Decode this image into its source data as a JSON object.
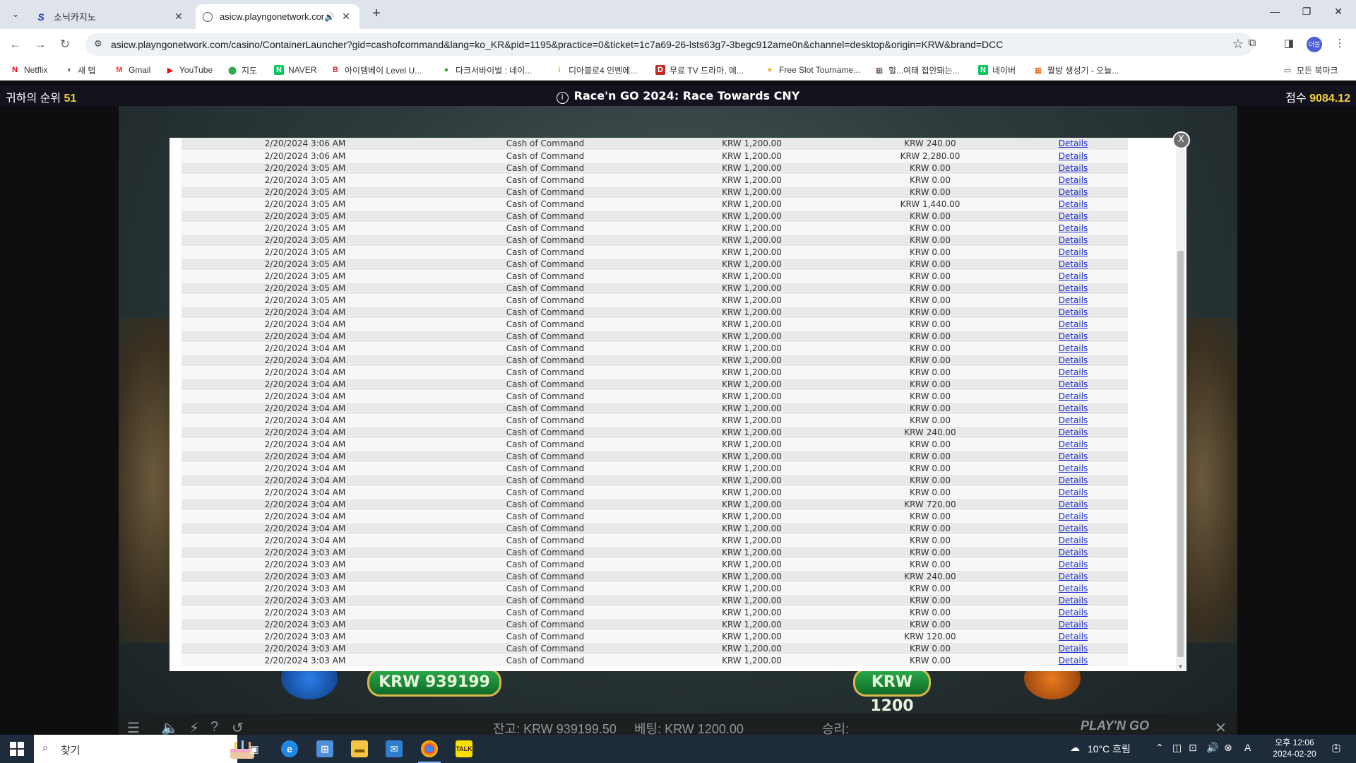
{
  "browser": {
    "tabs": [
      {
        "title": "소닉카지노",
        "active": false
      },
      {
        "title": "asicw.playngonetwork.com",
        "active": true
      }
    ],
    "new_tab": "+",
    "url": "asicw.playngonetwork.com/casino/ContainerLauncher?gid=cashofcommand&lang=ko_KR&pid=1195&practice=0&ticket=1c7a69-26-lsts63g7-3begc912ame0n&channel=desktop&origin=KRW&brand=DCC",
    "profile_initials": "더블",
    "bookmarks": [
      {
        "label": "Netflix",
        "icon": "N",
        "color": "#e50914"
      },
      {
        "label": "새 탭",
        "icon": "◑",
        "color": "#444444"
      },
      {
        "label": "Gmail",
        "icon": "M",
        "color": "#ea4335"
      },
      {
        "label": "YouTube",
        "icon": "▶",
        "color": "#ff0000"
      },
      {
        "label": "지도",
        "icon": "⬤",
        "color": "#34a853"
      },
      {
        "label": "NAVER",
        "icon": "N",
        "color": "#03c75a"
      },
      {
        "label": "아이템베이 Level U...",
        "icon": "B",
        "color": "#d32f2f"
      },
      {
        "label": "다크서바이벌 : 네이...",
        "icon": "●",
        "color": "#43a047"
      },
      {
        "label": "디아블로4 인벤에...",
        "icon": "i",
        "color": "#f9a825"
      },
      {
        "label": "무료 TV 드라마, 예...",
        "icon": "D",
        "color": "#c62828"
      },
      {
        "label": "Free Slot Tourname...",
        "icon": "●",
        "color": "#f0b429"
      },
      {
        "label": "헐...여태 접안돼는...",
        "icon": "▦",
        "color": "#6d4c41"
      },
      {
        "label": "네이버",
        "icon": "N",
        "color": "#03c75a"
      },
      {
        "label": "짤방 생성기 - 오늘...",
        "icon": "▦",
        "color": "#e65100"
      }
    ],
    "all_bookmarks": "모든 북마크"
  },
  "game": {
    "rank_label": "귀하의 순위",
    "rank_value": "51",
    "race_title": "Race'n GO 2024: Race Towards CNY",
    "score_label": "점수",
    "score_value": "9084.12",
    "pill_left": "KRW 939199",
    "pill_right": "KRW 1200",
    "balance": "잔고: KRW 939199.50",
    "bet": "베팅: KRW 1200.00",
    "win": "승리:",
    "provider": "PLAY'N GO",
    "close_glyph": "✕"
  },
  "modal": {
    "close_label": "X",
    "details_label": "Details",
    "rows": [
      [
        "2/20/2024 3:06 AM",
        "Cash of Command",
        "KRW 1,200.00",
        "KRW 240.00"
      ],
      [
        "2/20/2024 3:06 AM",
        "Cash of Command",
        "KRW 1,200.00",
        "KRW 2,280.00"
      ],
      [
        "2/20/2024 3:05 AM",
        "Cash of Command",
        "KRW 1,200.00",
        "KRW 0.00"
      ],
      [
        "2/20/2024 3:05 AM",
        "Cash of Command",
        "KRW 1,200.00",
        "KRW 0.00"
      ],
      [
        "2/20/2024 3:05 AM",
        "Cash of Command",
        "KRW 1,200.00",
        "KRW 0.00"
      ],
      [
        "2/20/2024 3:05 AM",
        "Cash of Command",
        "KRW 1,200.00",
        "KRW 1,440.00"
      ],
      [
        "2/20/2024 3:05 AM",
        "Cash of Command",
        "KRW 1,200.00",
        "KRW 0.00"
      ],
      [
        "2/20/2024 3:05 AM",
        "Cash of Command",
        "KRW 1,200.00",
        "KRW 0.00"
      ],
      [
        "2/20/2024 3:05 AM",
        "Cash of Command",
        "KRW 1,200.00",
        "KRW 0.00"
      ],
      [
        "2/20/2024 3:05 AM",
        "Cash of Command",
        "KRW 1,200.00",
        "KRW 0.00"
      ],
      [
        "2/20/2024 3:05 AM",
        "Cash of Command",
        "KRW 1,200.00",
        "KRW 0.00"
      ],
      [
        "2/20/2024 3:05 AM",
        "Cash of Command",
        "KRW 1,200.00",
        "KRW 0.00"
      ],
      [
        "2/20/2024 3:05 AM",
        "Cash of Command",
        "KRW 1,200.00",
        "KRW 0.00"
      ],
      [
        "2/20/2024 3:05 AM",
        "Cash of Command",
        "KRW 1,200.00",
        "KRW 0.00"
      ],
      [
        "2/20/2024 3:04 AM",
        "Cash of Command",
        "KRW 1,200.00",
        "KRW 0.00"
      ],
      [
        "2/20/2024 3:04 AM",
        "Cash of Command",
        "KRW 1,200.00",
        "KRW 0.00"
      ],
      [
        "2/20/2024 3:04 AM",
        "Cash of Command",
        "KRW 1,200.00",
        "KRW 0.00"
      ],
      [
        "2/20/2024 3:04 AM",
        "Cash of Command",
        "KRW 1,200.00",
        "KRW 0.00"
      ],
      [
        "2/20/2024 3:04 AM",
        "Cash of Command",
        "KRW 1,200.00",
        "KRW 0.00"
      ],
      [
        "2/20/2024 3:04 AM",
        "Cash of Command",
        "KRW 1,200.00",
        "KRW 0.00"
      ],
      [
        "2/20/2024 3:04 AM",
        "Cash of Command",
        "KRW 1,200.00",
        "KRW 0.00"
      ],
      [
        "2/20/2024 3:04 AM",
        "Cash of Command",
        "KRW 1,200.00",
        "KRW 0.00"
      ],
      [
        "2/20/2024 3:04 AM",
        "Cash of Command",
        "KRW 1,200.00",
        "KRW 0.00"
      ],
      [
        "2/20/2024 3:04 AM",
        "Cash of Command",
        "KRW 1,200.00",
        "KRW 0.00"
      ],
      [
        "2/20/2024 3:04 AM",
        "Cash of Command",
        "KRW 1,200.00",
        "KRW 240.00"
      ],
      [
        "2/20/2024 3:04 AM",
        "Cash of Command",
        "KRW 1,200.00",
        "KRW 0.00"
      ],
      [
        "2/20/2024 3:04 AM",
        "Cash of Command",
        "KRW 1,200.00",
        "KRW 0.00"
      ],
      [
        "2/20/2024 3:04 AM",
        "Cash of Command",
        "KRW 1,200.00",
        "KRW 0.00"
      ],
      [
        "2/20/2024 3:04 AM",
        "Cash of Command",
        "KRW 1,200.00",
        "KRW 0.00"
      ],
      [
        "2/20/2024 3:04 AM",
        "Cash of Command",
        "KRW 1,200.00",
        "KRW 0.00"
      ],
      [
        "2/20/2024 3:04 AM",
        "Cash of Command",
        "KRW 1,200.00",
        "KRW 720.00"
      ],
      [
        "2/20/2024 3:04 AM",
        "Cash of Command",
        "KRW 1,200.00",
        "KRW 0.00"
      ],
      [
        "2/20/2024 3:04 AM",
        "Cash of Command",
        "KRW 1,200.00",
        "KRW 0.00"
      ],
      [
        "2/20/2024 3:04 AM",
        "Cash of Command",
        "KRW 1,200.00",
        "KRW 0.00"
      ],
      [
        "2/20/2024 3:03 AM",
        "Cash of Command",
        "KRW 1,200.00",
        "KRW 0.00"
      ],
      [
        "2/20/2024 3:03 AM",
        "Cash of Command",
        "KRW 1,200.00",
        "KRW 0.00"
      ],
      [
        "2/20/2024 3:03 AM",
        "Cash of Command",
        "KRW 1,200.00",
        "KRW 240.00"
      ],
      [
        "2/20/2024 3:03 AM",
        "Cash of Command",
        "KRW 1,200.00",
        "KRW 0.00"
      ],
      [
        "2/20/2024 3:03 AM",
        "Cash of Command",
        "KRW 1,200.00",
        "KRW 0.00"
      ],
      [
        "2/20/2024 3:03 AM",
        "Cash of Command",
        "KRW 1,200.00",
        "KRW 0.00"
      ],
      [
        "2/20/2024 3:03 AM",
        "Cash of Command",
        "KRW 1,200.00",
        "KRW 0.00"
      ],
      [
        "2/20/2024 3:03 AM",
        "Cash of Command",
        "KRW 1,200.00",
        "KRW 120.00"
      ],
      [
        "2/20/2024 3:03 AM",
        "Cash of Command",
        "KRW 1,200.00",
        "KRW 0.00"
      ],
      [
        "2/20/2024 3:03 AM",
        "Cash of Command",
        "KRW 1,200.00",
        "KRW 0.00"
      ]
    ]
  },
  "taskbar": {
    "search_placeholder": "찾기",
    "weather": "10°C 흐림",
    "ime": "A",
    "clock_time": "오후 12:06",
    "clock_date": "2024-02-20",
    "notification_count": "1"
  },
  "colors": {
    "link": "#1b2ad2",
    "gold": "#f4d03f",
    "row_odd": "#e9e9e9",
    "row_even": "#f6f6f6"
  }
}
